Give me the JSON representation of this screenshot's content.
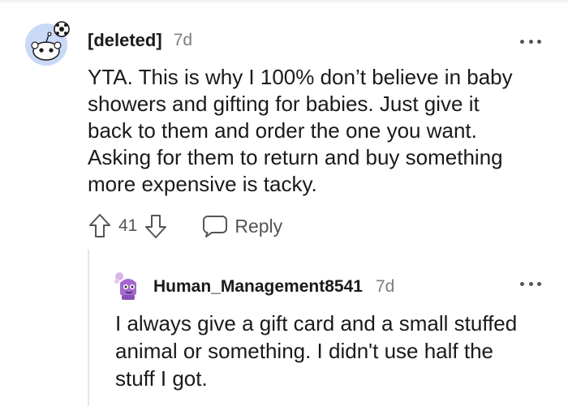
{
  "comment": {
    "author": "[deleted]",
    "age": "7d",
    "body": "YTA. This is why I 100% don’t believe in baby\nshowers and gifting for babies. Just give it\nback to them and order the one you want.\nAsking for them to return and buy something\nmore expensive is tacky.",
    "votes": "41",
    "reply_label": "Reply"
  },
  "reply": {
    "author": "Human_Management8541",
    "age": "7d",
    "body": "I always give a gift card and a small stuffed\nanimal or something. I didn't use half the\nstuff I got."
  },
  "icons": [
    "snoo-avatar-icon",
    "more-options-icon",
    "upvote-icon",
    "downvote-icon",
    "comment-bubble-icon",
    "user-avatar-icon"
  ],
  "colors": {
    "avatar_blue": "#c9d9f7",
    "snoo_orange": "#ff4500",
    "avatar_purple": "#a46ad1"
  }
}
